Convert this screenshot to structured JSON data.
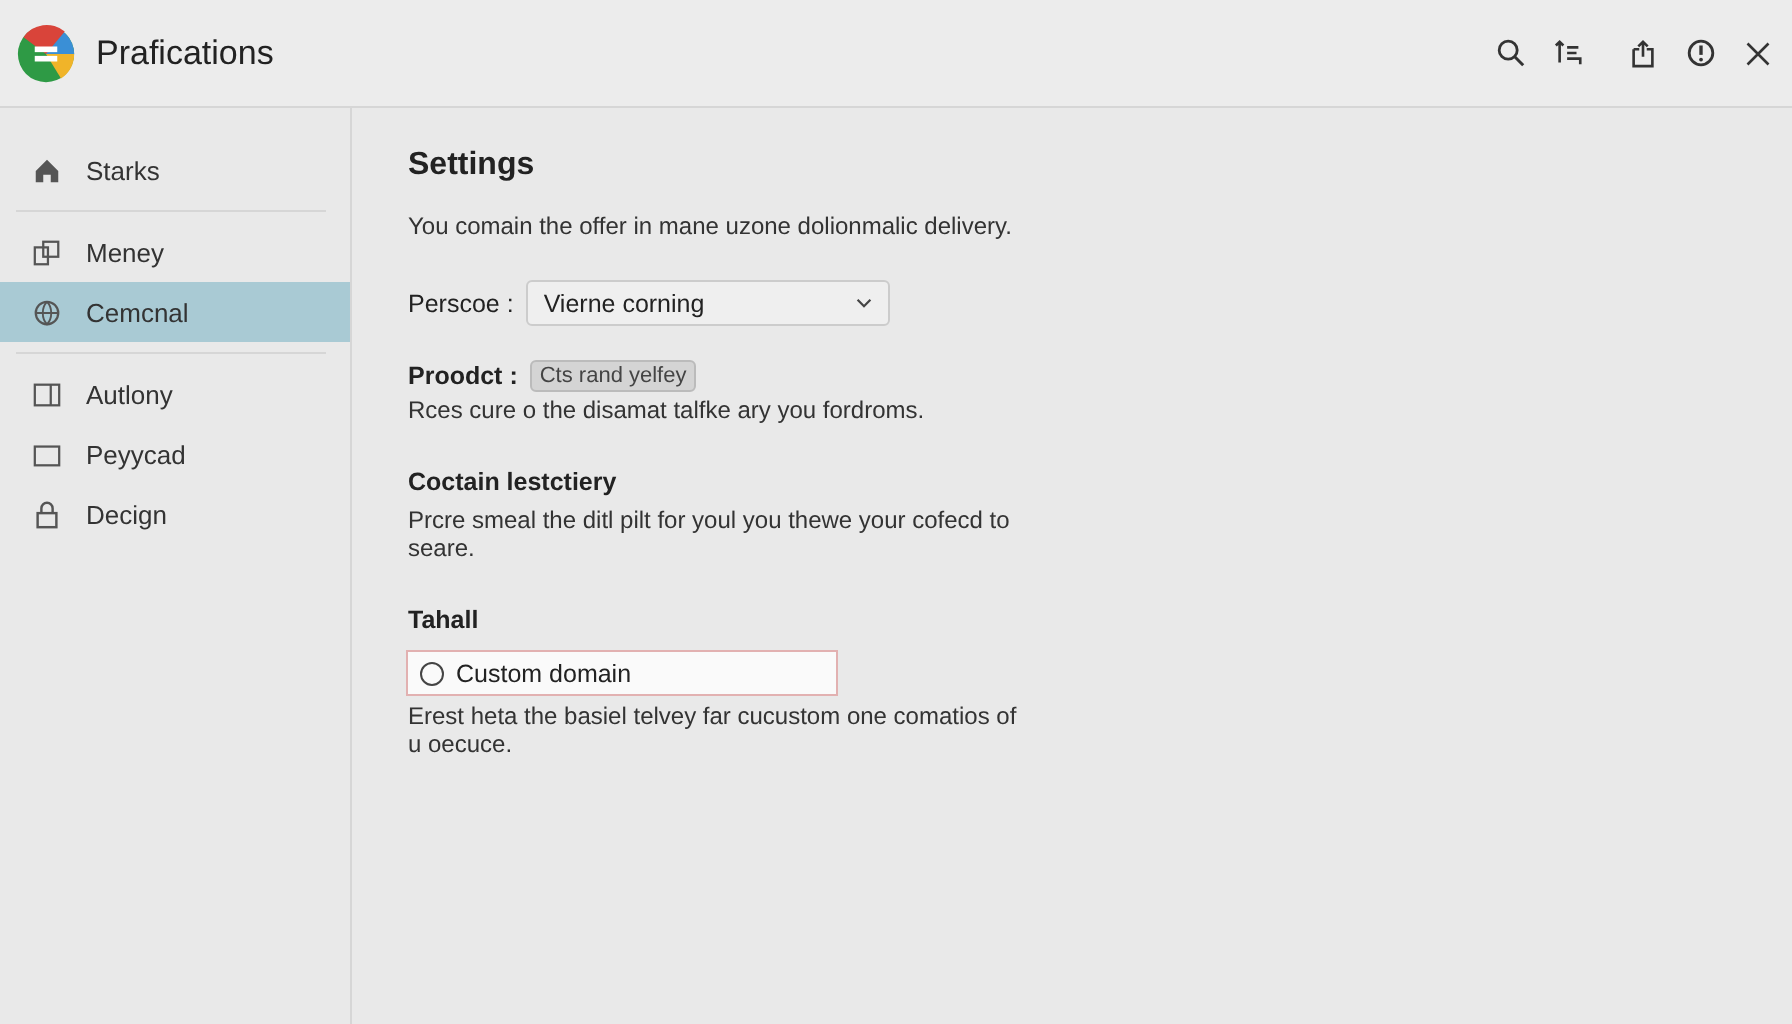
{
  "window": {
    "title": "Prafications"
  },
  "sidebar": {
    "groups": [
      [
        {
          "label": "Starks",
          "selected": false
        }
      ],
      [
        {
          "label": "Meney",
          "selected": false
        },
        {
          "label": "Cemcnal",
          "selected": true
        }
      ],
      [
        {
          "label": "Autlony",
          "selected": false
        },
        {
          "label": "Peyycad",
          "selected": false
        },
        {
          "label": "Decign",
          "selected": false
        }
      ]
    ]
  },
  "content": {
    "title": "Settings",
    "description": "You comain the offer in mane uzone dolionmalic delivery.",
    "persona": {
      "label": "Perscoe :",
      "value": "Vierne corning"
    },
    "product": {
      "label": "Proodct :",
      "chip": "Cts rand yelfey",
      "description": "Rces cure o the disamat talfke ary you fordroms."
    },
    "sections": [
      {
        "heading": "Coctain lestctiery",
        "text": "Prcre smeal the ditl pilt for youl you thewe your cofecd to seare."
      },
      {
        "heading": "Tahall",
        "option": {
          "label": "Custom domain",
          "checked": false
        },
        "text": "Erest heta the basiel telvey far cucustom one comatios of u oecuce."
      }
    ]
  }
}
